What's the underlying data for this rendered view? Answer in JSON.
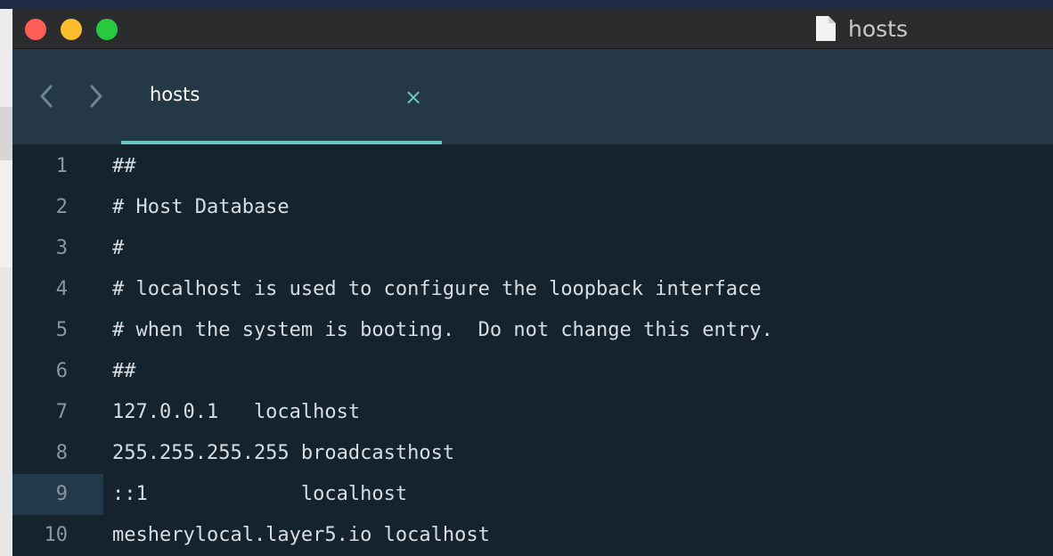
{
  "window": {
    "title": "hosts"
  },
  "tabs": [
    {
      "label": "hosts",
      "close": "×"
    }
  ],
  "editor": {
    "current_line": 9,
    "lines": [
      {
        "n": "1",
        "text": "##"
      },
      {
        "n": "2",
        "text": "# Host Database"
      },
      {
        "n": "3",
        "text": "#"
      },
      {
        "n": "4",
        "text": "# localhost is used to configure the loopback interface"
      },
      {
        "n": "5",
        "text": "# when the system is booting.  Do not change this entry."
      },
      {
        "n": "6",
        "text": "##"
      },
      {
        "n": "7",
        "text": "127.0.0.1   localhost"
      },
      {
        "n": "8",
        "text": "255.255.255.255 broadcasthost"
      },
      {
        "n": "9",
        "text": "::1             localhost"
      },
      {
        "n": "10",
        "text": "mesherylocal.layer5.io localhost"
      }
    ]
  },
  "colors": {
    "accent": "#6ac7c2",
    "editor_bg": "#15232e",
    "tabbar_bg": "#253845",
    "titlebar_bg": "#2b2c2e",
    "current_line_bg": "#22394a"
  },
  "icons": {
    "close": "close-icon",
    "minimize": "minimize-icon",
    "maximize": "maximize-icon",
    "document": "document-icon",
    "back": "chevron-left-icon",
    "forward": "chevron-right-icon",
    "tab_close": "close-icon"
  }
}
